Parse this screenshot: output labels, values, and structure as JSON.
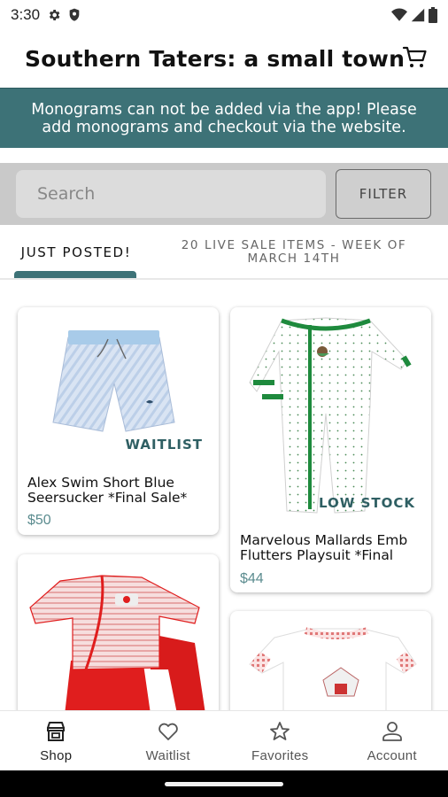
{
  "status_bar": {
    "time": "3:30"
  },
  "header": {
    "title": "Southern Taters: a small town"
  },
  "banner": {
    "line1": "Monograms can not be added via the app! Please",
    "line2": "add monograms and checkout via the website."
  },
  "search": {
    "placeholder": "Search",
    "filter_label": "FILTER"
  },
  "tabs": [
    {
      "label": "JUST POSTED!",
      "active": true
    },
    {
      "label_line1": "20 LIVE SALE ITEMS - WEEK OF",
      "label_line2": "MARCH 14TH",
      "active": false
    }
  ],
  "products": [
    {
      "badge": "WAITLIST",
      "name_line1": "Alex Swim Short Blue",
      "name_line2": "Seersucker *Final Sale*",
      "price": "$50"
    },
    {
      "badge": "LOW STOCK",
      "name_line1": "Marvelous Mallards Emb",
      "name_line2": "Flutters Playsuit *Final",
      "price": "$44"
    },
    {
      "badge": "",
      "name_line1": "",
      "name_line2": "",
      "price": ""
    },
    {
      "badge": "",
      "name_line1": "",
      "name_line2": "",
      "price": ""
    }
  ],
  "bottom_nav": [
    {
      "label": "Shop",
      "icon": "store-icon",
      "active": true
    },
    {
      "label": "Waitlist",
      "icon": "heart-icon",
      "active": false
    },
    {
      "label": "Favorites",
      "icon": "star-icon",
      "active": false
    },
    {
      "label": "Account",
      "icon": "person-icon",
      "active": false
    }
  ],
  "colors": {
    "accent": "#3d7277",
    "price": "#5b8c8f",
    "badge": "#2f5f63",
    "search_bg": "#c9c9c9"
  }
}
